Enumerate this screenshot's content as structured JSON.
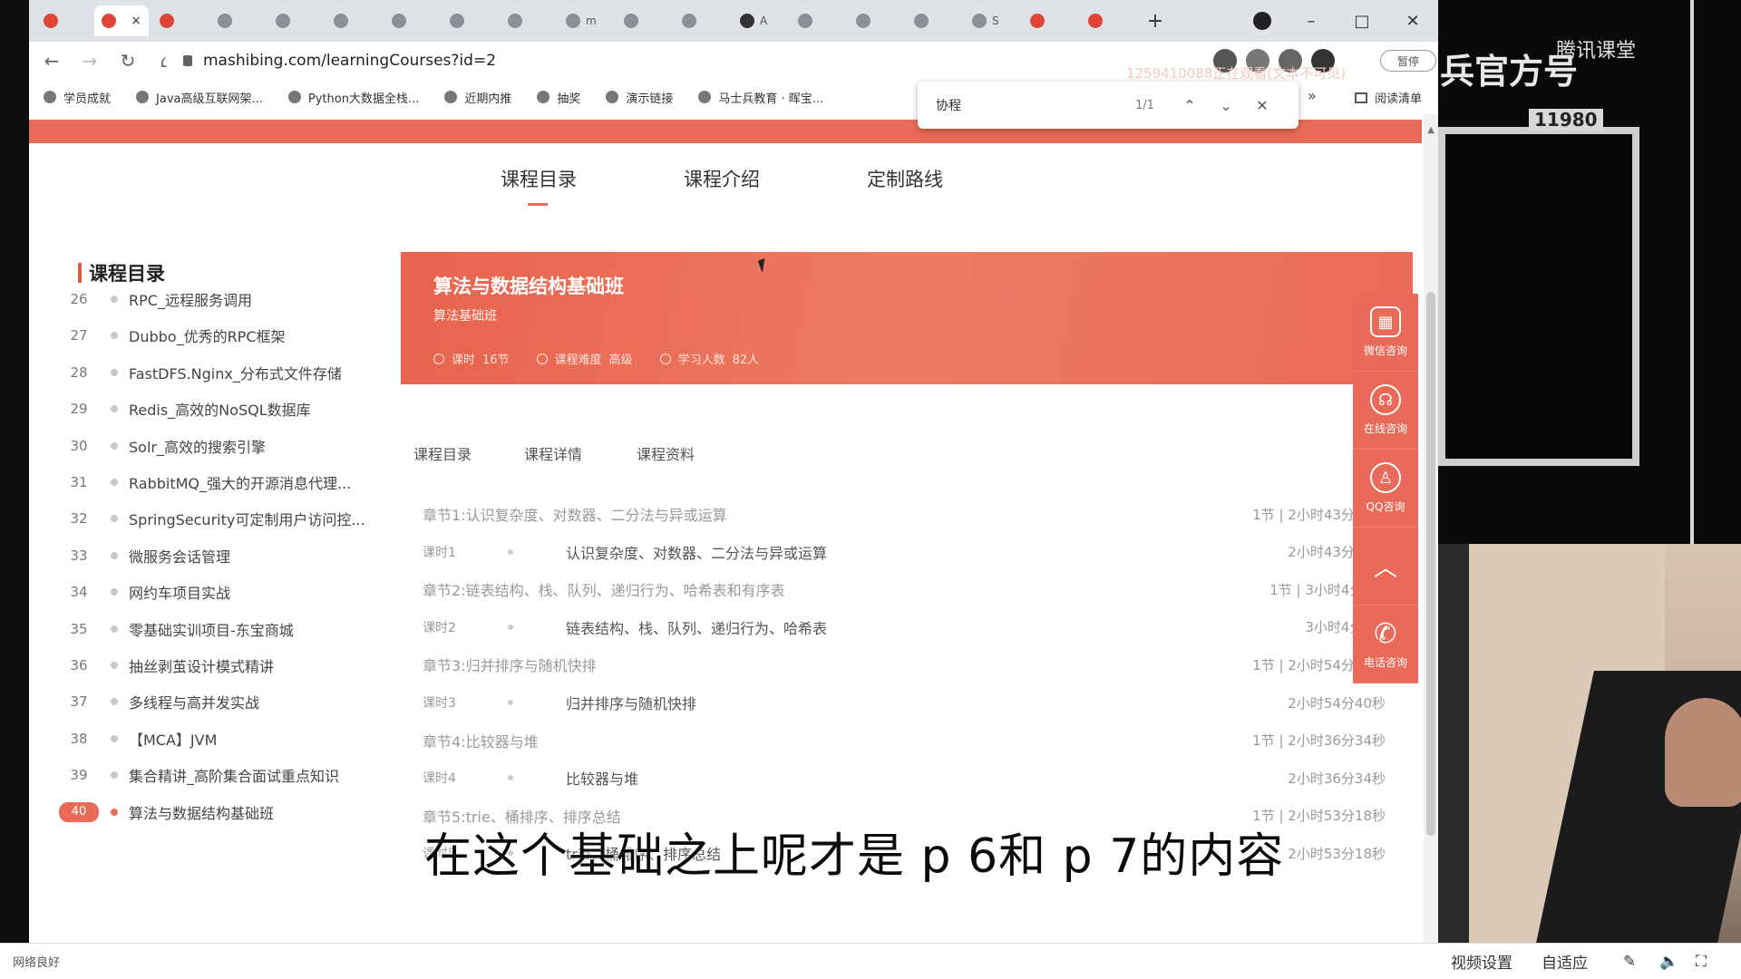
{
  "browser": {
    "tabs": [
      {
        "text": "",
        "favicon": "red"
      },
      {
        "text": "",
        "favicon": "red",
        "active": true,
        "close": "×"
      },
      {
        "text": "",
        "favicon": "red"
      },
      {
        "text": "",
        "favicon": "gray"
      },
      {
        "text": "",
        "favicon": "gray"
      },
      {
        "text": "",
        "favicon": "gray"
      },
      {
        "text": "",
        "favicon": "gray"
      },
      {
        "text": "",
        "favicon": "gray"
      },
      {
        "text": "",
        "favicon": "gray"
      },
      {
        "text": "m",
        "favicon": "gray"
      },
      {
        "text": "",
        "favicon": "gray"
      },
      {
        "text": "",
        "favicon": "gray"
      },
      {
        "text": "A",
        "favicon": "dark"
      },
      {
        "text": "",
        "favicon": "gray"
      },
      {
        "text": "",
        "favicon": "gray"
      },
      {
        "text": "",
        "favicon": "gray"
      },
      {
        "text": "S",
        "favicon": "gray"
      },
      {
        "text": "",
        "favicon": "red"
      },
      {
        "text": "",
        "favicon": "red"
      }
    ],
    "new_tab": "+",
    "window_controls": {
      "minimize": "–",
      "maximize": "□",
      "close": "✕"
    },
    "url": "mashibing.com/learningCourses?id=2",
    "profile_label": "暂停",
    "bookmarks": [
      "学员成就",
      "Java高级互联网架...",
      "Python大数据全栈...",
      "近期内推",
      "抽奖",
      "演示链接",
      "马士兵教育 · 晖宝..."
    ],
    "bookmarks_more": "»",
    "reading_list": "阅读清单",
    "find": {
      "value": "协程",
      "count": "1/1",
      "prev": "⌃",
      "next": "⌄",
      "close": "✕"
    },
    "watermark_id": "1259410088正在观看(文本不可见)"
  },
  "page": {
    "top_tabs": [
      "课程目录",
      "课程介绍",
      "定制路线"
    ],
    "sidebar_title": "课程目录",
    "sidebar_items": [
      {
        "num": "26",
        "label": "RPC_远程服务调用"
      },
      {
        "num": "27",
        "label": "Dubbo_优秀的RPC框架"
      },
      {
        "num": "28",
        "label": "FastDFS.Nginx_分布式文件存储"
      },
      {
        "num": "29",
        "label": "Redis_高效的NoSQL数据库"
      },
      {
        "num": "30",
        "label": "Solr_高效的搜索引擎"
      },
      {
        "num": "31",
        "label": "RabbitMQ_强大的开源消息代理..."
      },
      {
        "num": "32",
        "label": "SpringSecurity可定制用户访问控..."
      },
      {
        "num": "33",
        "label": "微服务会话管理"
      },
      {
        "num": "34",
        "label": "网约车项目实战"
      },
      {
        "num": "35",
        "label": "零基础实训项目-东宝商城"
      },
      {
        "num": "36",
        "label": "抽丝剥茧设计模式精讲"
      },
      {
        "num": "37",
        "label": "多线程与高并发实战"
      },
      {
        "num": "38",
        "label": "【MCA】JVM"
      },
      {
        "num": "39",
        "label": "集合精讲_高阶集合面试重点知识"
      },
      {
        "num": "40",
        "label": "算法与数据结构基础班",
        "current": true
      }
    ],
    "banner": {
      "title": "算法与数据结构基础班",
      "subtitle": "算法基础班",
      "meta": [
        {
          "label": "课时",
          "value": "16节"
        },
        {
          "label": "课程难度",
          "value": "高级"
        },
        {
          "label": "学习人数",
          "value": "82人"
        }
      ]
    },
    "sub_tabs": [
      "课程目录",
      "课程详情",
      "课程资料"
    ],
    "rows": [
      {
        "type": "chapter",
        "left": "章节1:认识复杂度、对数器、二分法与异或运算",
        "right": "1节 | 2小时43分35秒"
      },
      {
        "type": "lesson",
        "num": "课时1",
        "title": "认识复杂度、对数器、二分法与异或运算",
        "right": "2小时43分35秒"
      },
      {
        "type": "chapter",
        "left": "章节2:链表结构、栈、队列、递归行为、哈希表和有序表",
        "right": "1节 | 3小时4分7秒"
      },
      {
        "type": "lesson",
        "num": "课时2",
        "title": "链表结构、栈、队列、递归行为、哈希表",
        "right": "3小时4分7秒"
      },
      {
        "type": "chapter",
        "left": "章节3:归并排序与随机快排",
        "right": "1节 | 2小时54分40秒"
      },
      {
        "type": "lesson",
        "num": "课时3",
        "title": "归并排序与随机快排",
        "right": "2小时54分40秒"
      },
      {
        "type": "chapter",
        "left": "章节4:比较器与堆",
        "right": "1节 | 2小时36分34秒"
      },
      {
        "type": "lesson",
        "num": "课时4",
        "title": "比较器与堆",
        "right": "2小时36分34秒"
      },
      {
        "type": "chapter",
        "left": "章节5:trie、桶排序、排序总结",
        "right": "1节 | 2小时53分18秒"
      },
      {
        "type": "lesson",
        "num": "课时5",
        "title": "trie、桶排序、排序总结",
        "right": "2小时53分18秒"
      }
    ],
    "float_bar": [
      "微信咨询",
      "在线咨询",
      "QQ咨询",
      "",
      "电话咨询"
    ]
  },
  "overlay": {
    "subtitle": "在这个基础之上呢才是 p 6和 p 7的内容",
    "brand_text": "兵官方号",
    "brand_mark": "腾讯课堂",
    "viewer_count": "11980"
  },
  "player": {
    "network": "网络良好",
    "video_settings": "视频设置",
    "fit": "自适应"
  },
  "colors": {
    "accent": "#e86b58",
    "banner": "#e8634d"
  }
}
